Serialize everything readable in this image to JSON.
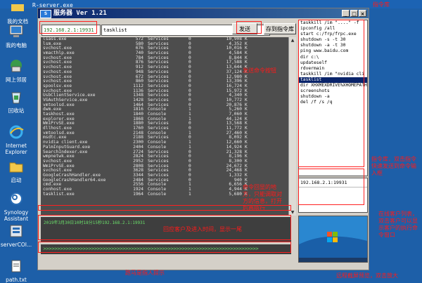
{
  "desktop": {
    "top_file": "R-server.exe",
    "icons": [
      {
        "label": "我的文档",
        "icon": "documents-folder-icon"
      },
      {
        "label": "我的电脑",
        "icon": "computer-icon"
      },
      {
        "label": "网上邻居",
        "icon": "network-icon"
      },
      {
        "label": "回收站",
        "icon": "recycle-bin-icon"
      },
      {
        "label": "Internet Explorer",
        "icon": "ie-icon"
      },
      {
        "label": "启动",
        "icon": "startup-folder-icon"
      },
      {
        "label": "Synology Assistant",
        "icon": "synology-icon"
      },
      {
        "label": "serverCOI...",
        "icon": "server-app-icon"
      },
      {
        "label": "path.txt",
        "icon": "text-file-icon"
      }
    ]
  },
  "window": {
    "title": "服务器 Ver 1.21",
    "min": "_",
    "max": "□",
    "close": "×"
  },
  "toolbar": {
    "ip_value": "192.168.2.1:19931",
    "command_value": "tasklist",
    "send_label": "发送",
    "save_label": "存到指令库"
  },
  "process_list": [
    [
      "lsass.exe",
      "572",
      "Services",
      "0",
      "10,908",
      "K"
    ],
    [
      "lsm.exe",
      "580",
      "Services",
      "0",
      "4,352",
      "K"
    ],
    [
      "svchost.exe",
      "676",
      "Services",
      "0",
      "10,016",
      "K"
    ],
    [
      "vmacthlp.exe",
      "740",
      "Services",
      "0",
      "4,584",
      "K"
    ],
    [
      "svchost.exe",
      "784",
      "Services",
      "0",
      "8,844",
      "K"
    ],
    [
      "svchost.exe",
      "876",
      "Services",
      "0",
      "17,588",
      "K"
    ],
    [
      "svchost.exe",
      "912",
      "Services",
      "0",
      "13,644",
      "K"
    ],
    [
      "svchost.exe",
      "948",
      "Services",
      "0",
      "37,124",
      "K"
    ],
    [
      "svchost.exe",
      "672",
      "Services",
      "0",
      "12,980",
      "K"
    ],
    [
      "svchost.exe",
      "860",
      "Services",
      "0",
      "13,396",
      "K"
    ],
    [
      "spoolsv.exe",
      "1112",
      "Services",
      "0",
      "16,724",
      "K"
    ],
    [
      "svchost.exe",
      "1136",
      "Services",
      "0",
      "15,972",
      "K"
    ],
    [
      "UsbClientService.exe",
      "1348",
      "Services",
      "0",
      "4,340",
      "K"
    ],
    [
      "VGAuthService.exe",
      "1428",
      "Services",
      "0",
      "10,772",
      "K"
    ],
    [
      "vmtoolsd.exe",
      "1464",
      "Services",
      "0",
      "20,876",
      "K"
    ],
    [
      "dwm.exe",
      "1816",
      "Console",
      "1",
      "5,260",
      "K"
    ],
    [
      "taskhost.exe",
      "1840",
      "Console",
      "1",
      "7,060",
      "K"
    ],
    [
      "explorer.exe",
      "1868",
      "Console",
      "1",
      "44,124",
      "K"
    ],
    [
      "WmiPrvSE.exe",
      "1880",
      "Services",
      "0",
      "13,568",
      "K"
    ],
    [
      "dllhost.exe",
      "1760",
      "Services",
      "0",
      "11,772",
      "K"
    ],
    [
      "vmtoolsd.exe",
      "2148",
      "Console",
      "1",
      "27,460",
      "K"
    ],
    [
      "msdtc.exe",
      "2188",
      "Services",
      "0",
      "8,092",
      "K"
    ],
    [
      "nvidia client.exe",
      "2300",
      "Console",
      "1",
      "12,660",
      "K"
    ],
    [
      "PalmInputGuard.exe",
      "2404",
      "Console",
      "1",
      "14,924",
      "K"
    ],
    [
      "SearchIndexer.exe",
      "2724",
      "Services",
      "0",
      "21,328",
      "K"
    ],
    [
      "wmpnetwk.exe",
      "2824",
      "Services",
      "0",
      "8,196",
      "K"
    ],
    [
      "svchost.exe",
      "2952",
      "Services",
      "0",
      "8,300",
      "K"
    ],
    [
      "WmiPrvSE.exe",
      "2808",
      "Services",
      "0",
      "24,672",
      "K"
    ],
    [
      "svchost.exe",
      "3628",
      "Services",
      "0",
      "24,468",
      "K"
    ],
    [
      "GoogleCrashHandler.exe",
      "3344",
      "Services",
      "0",
      "1,332",
      "K"
    ],
    [
      "GoogleCrashHandler64.exe",
      "2484",
      "Services",
      "0",
      "940",
      "K"
    ],
    [
      "cmd.exe",
      "2556",
      "Console",
      "1",
      "6,656",
      "K"
    ],
    [
      "conhost.exe",
      "1924",
      "Console",
      "1",
      "4,944",
      "K"
    ],
    [
      "tasklist.exe",
      "1964",
      "Console",
      "1",
      "5,680",
      "K"
    ]
  ],
  "command_library": [
    "taskkill /im \"....\" -f",
    "ipconfig /all",
    "start c:/frp/frpc.exe",
    "shutdown -s -t 30",
    "shutdown -a -t 30",
    "ping www.baidu.com",
    "dir c:\\",
    "updateself",
    "rdvermain",
    "taskkill /im \"nvidia cli",
    "tasklist",
    "dir XHXMEXDRIVE%XHOMEPATH%",
    "screenshots",
    "shutdown -a",
    "del /f /s /q"
  ],
  "selected_command_index": 10,
  "clients": [
    "192.168.2.1:19931"
  ],
  "status_line": "2019年3月30日10时18分15秒192.168.2.1:19931",
  "input_hint": ">>>>>>>>>>>>>>>>>>>>>>>>>>>>>>>>>>>>>>>>>>>>>>>>>>>>>>>>>>>>>>>>>>>>>>>>>>>>",
  "annotations": {
    "top_right": "指令库",
    "send_note": "发送命令按钮",
    "middle_note": "命令回显的地方，只能调取对方的信息，打开后再执行",
    "status_note": "回应客户及进入时间，显示一尾",
    "input_note": "跑马是指人提示",
    "right_note_1": "指令库，双击指令快速发送到命令输入框",
    "right_note_2": "在线客户列表，双击客户可以显示客户的执行命令窗口",
    "bottom_note": "远程截屏预览，双击放大"
  }
}
